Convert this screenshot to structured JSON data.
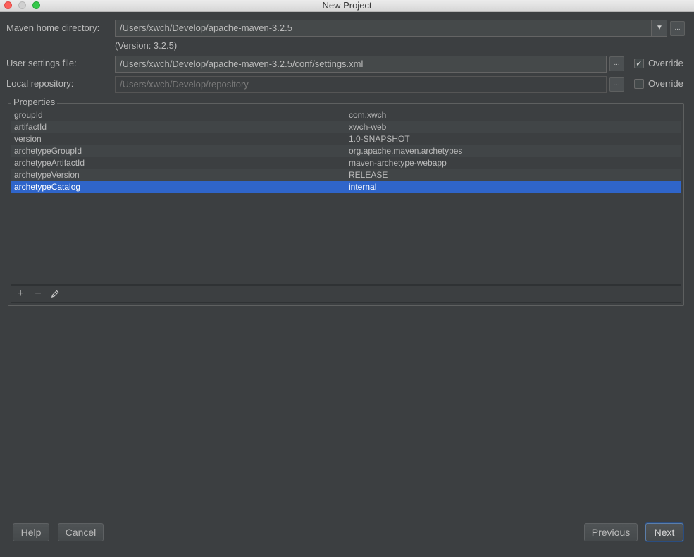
{
  "window": {
    "title": "New Project"
  },
  "maven_home": {
    "label": "Maven home directory:",
    "value": "/Users/xwch/Develop/apache-maven-3.2.5",
    "version": "(Version: 3.2.5)",
    "browse_label": "..."
  },
  "user_settings": {
    "label": "User settings file:",
    "value": "/Users/xwch/Develop/apache-maven-3.2.5/conf/settings.xml",
    "browse_label": "...",
    "override_label": "Override",
    "override_checked": true
  },
  "local_repo": {
    "label": "Local repository:",
    "value": "/Users/xwch/Develop/repository",
    "browse_label": "...",
    "override_label": "Override",
    "override_checked": false
  },
  "properties": {
    "title": "Properties",
    "rows": [
      {
        "key": "groupId",
        "value": "com.xwch"
      },
      {
        "key": "artifactId",
        "value": "xwch-web"
      },
      {
        "key": "version",
        "value": "1.0-SNAPSHOT"
      },
      {
        "key": "archetypeGroupId",
        "value": "org.apache.maven.archetypes"
      },
      {
        "key": "archetypeArtifactId",
        "value": "maven-archetype-webapp"
      },
      {
        "key": "archetypeVersion",
        "value": "RELEASE"
      },
      {
        "key": "archetypeCatalog",
        "value": "internal"
      }
    ],
    "selected_row": "archetypeCatalog",
    "toolbar": {
      "add": "+",
      "remove": "−"
    }
  },
  "buttons": {
    "help": "Help",
    "cancel": "Cancel",
    "previous": "Previous",
    "next": "Next"
  },
  "colors": {
    "background": "#3c3f41",
    "selection": "#2f65ca",
    "text": "#bbbbbb"
  }
}
